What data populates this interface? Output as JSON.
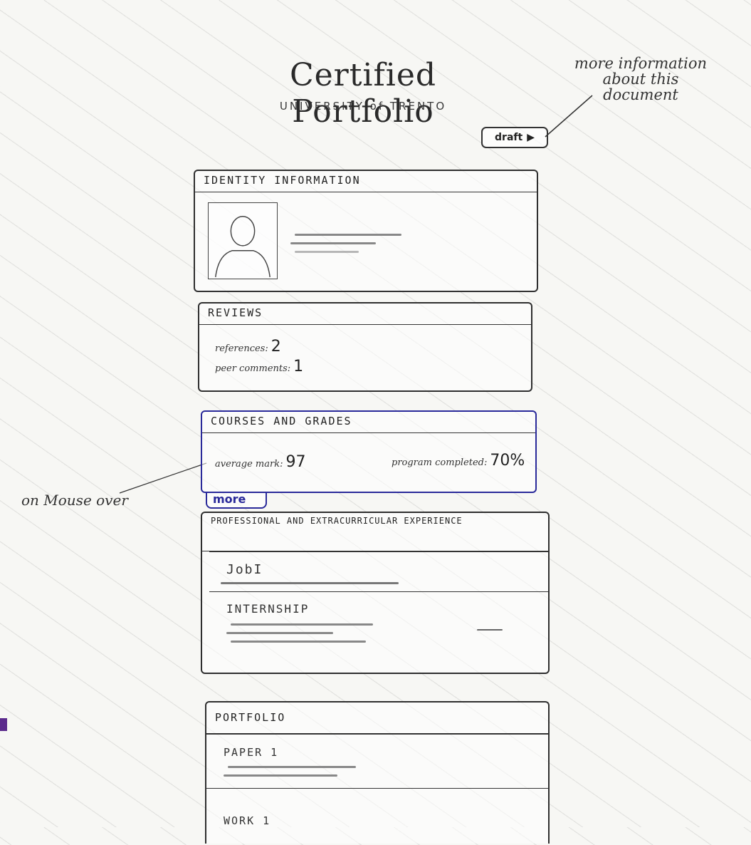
{
  "header": {
    "title": "Certified Portfolio",
    "subtitle": "UNIVERSITY of TRENTO",
    "draft_button_label": "draft"
  },
  "annotations": {
    "top_note": "more information about this document",
    "mouse_over_note": "on Mouse over"
  },
  "identity": {
    "heading": "IDENTITY INFORMATION"
  },
  "reviews": {
    "heading": "REVIEWS",
    "references_label": "references:",
    "references_value": "2",
    "peer_comments_label": "peer comments:",
    "peer_comments_value": "1"
  },
  "courses": {
    "heading": "COURSES AND GRADES",
    "average_mark_label": "average mark:",
    "average_mark_value": "97",
    "program_completed_label": "program completed:",
    "program_completed_value": "70%",
    "more_label": "more"
  },
  "experience": {
    "heading": "PROFESSIONAL AND EXTRACURRICULAR EXPERIENCE",
    "items": [
      {
        "label": "JobI"
      },
      {
        "label": "INTERNSHIP"
      }
    ]
  },
  "portfolio": {
    "heading": "PORTFOLIO",
    "items": [
      {
        "label": "PAPER 1"
      },
      {
        "label": "WORK 1"
      }
    ]
  },
  "colors": {
    "hover_highlight": "#2a2a9a",
    "marker": "#5b2a8c"
  }
}
